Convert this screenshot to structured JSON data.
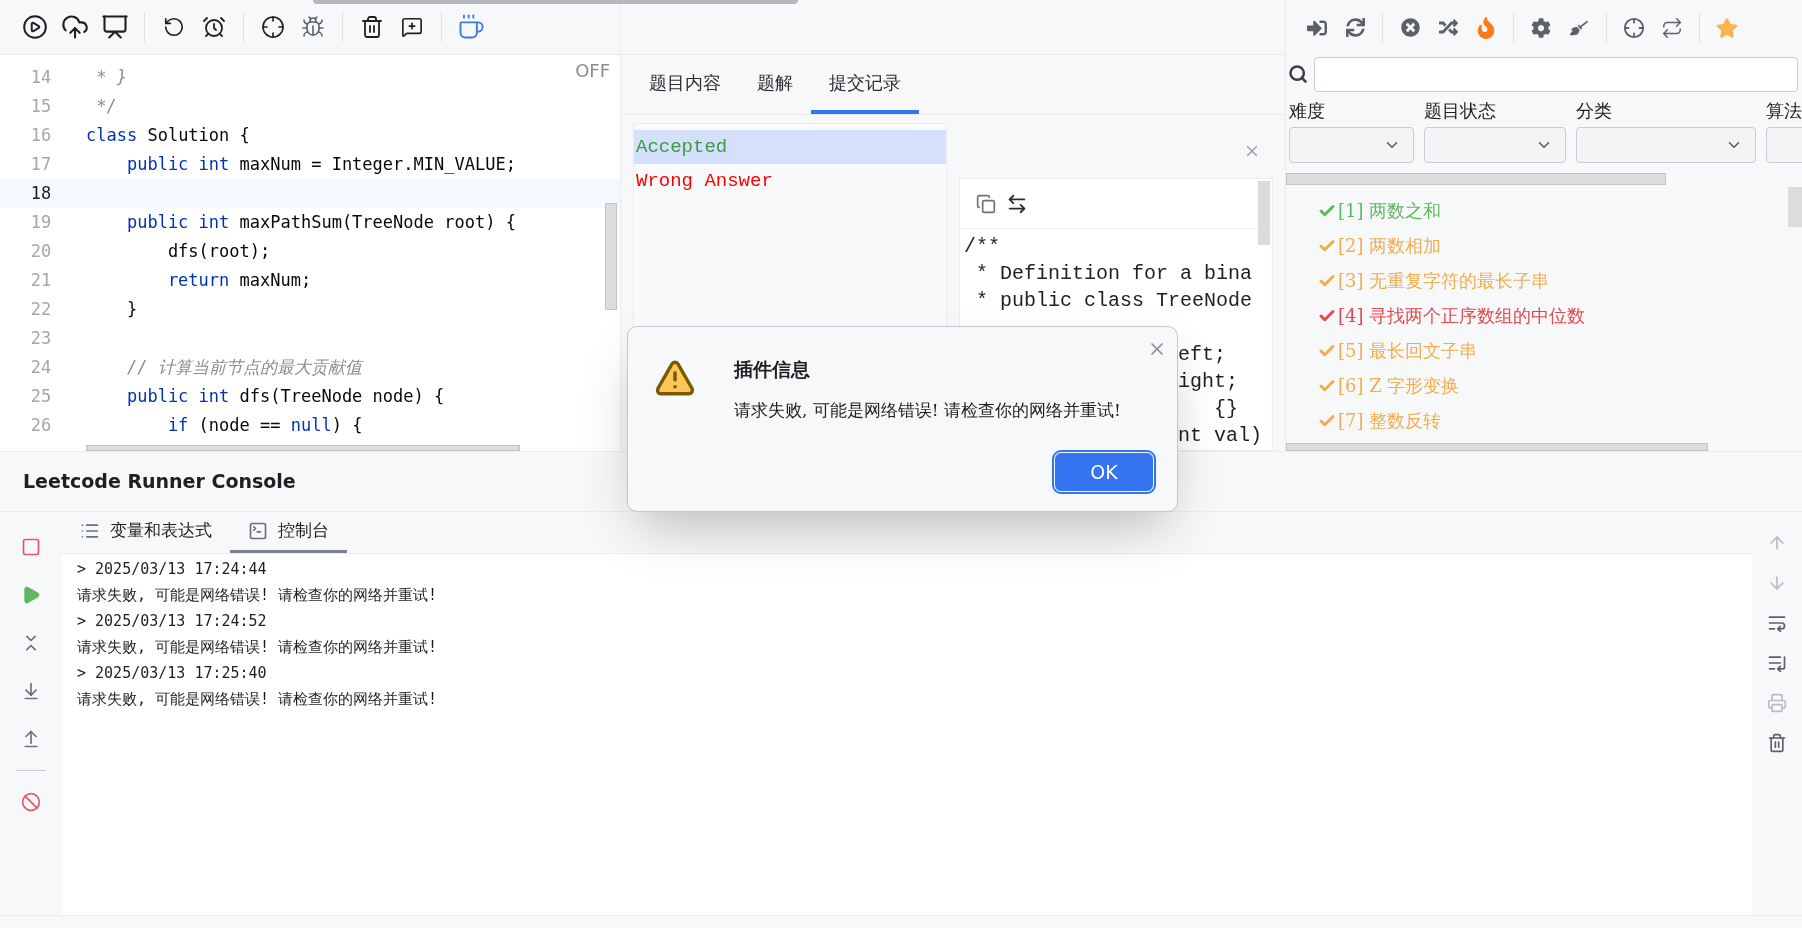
{
  "editor": {
    "status": "OFF",
    "lines": [
      {
        "number": "14",
        "current": false,
        "segments": [
          {
            "kind": "comment",
            "text": " * }"
          }
        ]
      },
      {
        "number": "15",
        "current": false,
        "segments": [
          {
            "kind": "comment",
            "text": " */"
          }
        ]
      },
      {
        "number": "16",
        "current": false,
        "segments": [
          {
            "kind": "keyword",
            "text": "class"
          },
          {
            "kind": "plain",
            "text": " Solution {"
          }
        ]
      },
      {
        "number": "17",
        "current": false,
        "segments": [
          {
            "kind": "keyword",
            "text": "    public int"
          },
          {
            "kind": "plain",
            "text": " maxNum = Integer.MIN_VALUE;"
          }
        ]
      },
      {
        "number": "18",
        "current": true
      },
      {
        "number": "19",
        "current": false,
        "segments": [
          {
            "kind": "keyword",
            "text": "    public int"
          },
          {
            "kind": "plain",
            "text": " maxPathSum(TreeNode root) {"
          }
        ]
      },
      {
        "number": "20",
        "current": false,
        "segments": [
          {
            "kind": "plain",
            "text": "        dfs(root);"
          }
        ]
      },
      {
        "number": "21",
        "current": false,
        "segments": [
          {
            "kind": "keyword",
            "text": "        return"
          },
          {
            "kind": "plain",
            "text": " maxNum;"
          }
        ]
      },
      {
        "number": "22",
        "current": false,
        "segments": [
          {
            "kind": "plain",
            "text": "    }"
          }
        ]
      },
      {
        "number": "23",
        "current": false
      },
      {
        "number": "24",
        "current": false,
        "segments": [
          {
            "kind": "comment",
            "text": "    // 计算当前节点的最大贡献值"
          }
        ]
      },
      {
        "number": "25",
        "current": false,
        "segments": [
          {
            "kind": "keyword",
            "text": "    public int"
          },
          {
            "kind": "plain",
            "text": " dfs(TreeNode node) {"
          }
        ]
      },
      {
        "number": "26",
        "current": false,
        "segments": [
          {
            "kind": "keyword",
            "text": "        if"
          },
          {
            "kind": "plain",
            "text": " (node == "
          },
          {
            "kind": "keyword",
            "text": "null"
          },
          {
            "kind": "plain",
            "text": ") {"
          }
        ]
      }
    ]
  },
  "problem_tabs": [
    {
      "label": "题目内容",
      "selected": false
    },
    {
      "label": "题解",
      "selected": false
    },
    {
      "label": "提交记录",
      "selected": true
    }
  ],
  "submissions": [
    {
      "label": "Accepted",
      "selected": true,
      "color": "#3d9c3d"
    },
    {
      "label": "Wrong Answer",
      "selected": false,
      "color": "#ff0000"
    }
  ],
  "submission_code": [
    {
      "kind": "line",
      "text": "/**"
    },
    {
      "kind": "line",
      "text": " * Definition for a bina"
    },
    {
      "kind": "line",
      "text": " * public class TreeNode"
    },
    {
      "kind": "tail",
      "text": "eft;"
    },
    {
      "kind": "tail",
      "text": "ight;"
    },
    {
      "kind": "tail",
      "text": "   {}"
    },
    {
      "kind": "tail",
      "text": "nt val)"
    }
  ],
  "filters": [
    {
      "label": "难度"
    },
    {
      "label": "题目状态"
    },
    {
      "label": "分类"
    },
    {
      "label": "算法"
    }
  ],
  "problems": [
    {
      "label": "[1] 两数之和",
      "color": "#5fb85f"
    },
    {
      "label": "[2] 两数相加",
      "color": "#f0ad4e"
    },
    {
      "label": "[3] 无重复字符的最长子串",
      "color": "#f0ad4e"
    },
    {
      "label": "[4] 寻找两个正序数组的中位数",
      "color": "#e5484d"
    },
    {
      "label": "[5] 最长回文子串",
      "color": "#f0ad4e"
    },
    {
      "label": "[6] Z 字形变换",
      "color": "#f0ad4e"
    },
    {
      "label": "[7] 整数反转",
      "color": "#f0ad4e"
    }
  ],
  "console": {
    "title": "Leetcode Runner Console",
    "tabs": [
      {
        "kind": "variables",
        "label": "变量和表达式",
        "selected": false
      },
      {
        "kind": "console",
        "label": "控制台",
        "selected": true
      }
    ],
    "lines": [
      "> 2025/03/13 17:24:44",
      "请求失败, 可能是网络错误! 请检查你的网络并重试!",
      "> 2025/03/13 17:24:52",
      "请求失败, 可能是网络错误! 请检查你的网络并重试!",
      "> 2025/03/13 17:25:40",
      "请求失败, 可能是网络错误! 请检查你的网络并重试!"
    ]
  },
  "dialog": {
    "title": "插件信息",
    "message": "请求失败, 可能是网络错误! 请检查你的网络并重试!",
    "button": "OK"
  }
}
